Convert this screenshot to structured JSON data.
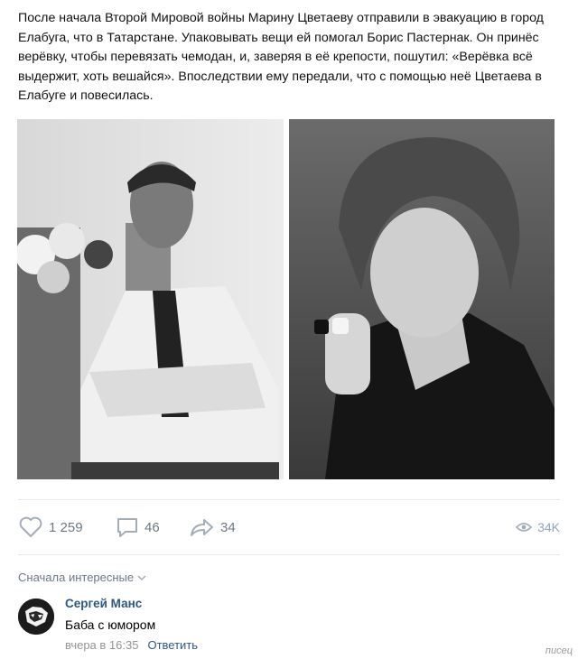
{
  "post": {
    "text": "После начала Второй Мировой войны Марину Цветаеву отправили в эвакуацию в город Елабуга, что в Татарстане. Упаковывать вещи ей помогал Борис Пастернак. Он принёс верёвку, чтобы перевязать чемодан, и, заверяя в её крепости, пошутил: «Верёвка всё выдержит, хоть вешайся». Впоследствии ему передали, что с помощью неё Цветаева в Елабуге и повесилась."
  },
  "actions": {
    "likes": "1 259",
    "comments": "46",
    "shares": "34",
    "views": "34K"
  },
  "comments_section": {
    "sort_label": "Сначала интересные",
    "items": [
      {
        "author": "Сергей Манс",
        "text": "Баба с юмором",
        "time": "вчера в 16:35",
        "reply_label": "Ответить"
      }
    ]
  },
  "watermark": "писец",
  "colors": {
    "link": "#2a5885",
    "secondary": "#6d7885",
    "muted": "#939393",
    "divider": "#e7e8ec"
  }
}
